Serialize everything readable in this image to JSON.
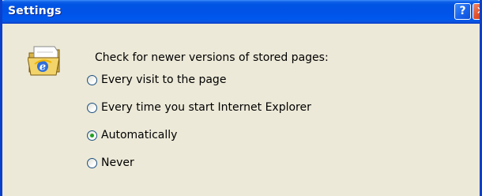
{
  "window": {
    "title": "Settings",
    "help_button": "?",
    "close_button": "✕"
  },
  "group": {
    "label": "Check for newer versions of stored pages:",
    "icon": "internet-explorer-folder-icon"
  },
  "options": [
    {
      "label": "Every visit to the page",
      "checked": false
    },
    {
      "label": "Every time you start Internet Explorer",
      "checked": false
    },
    {
      "label": "Automatically",
      "checked": true
    },
    {
      "label": "Never",
      "checked": false
    }
  ],
  "colors": {
    "titlebar": "#0054e3",
    "window_border": "#0a3fcc",
    "dialog_background": "#ece9d8",
    "close_button": "#e0502c",
    "radio_dot": "#21a121"
  }
}
